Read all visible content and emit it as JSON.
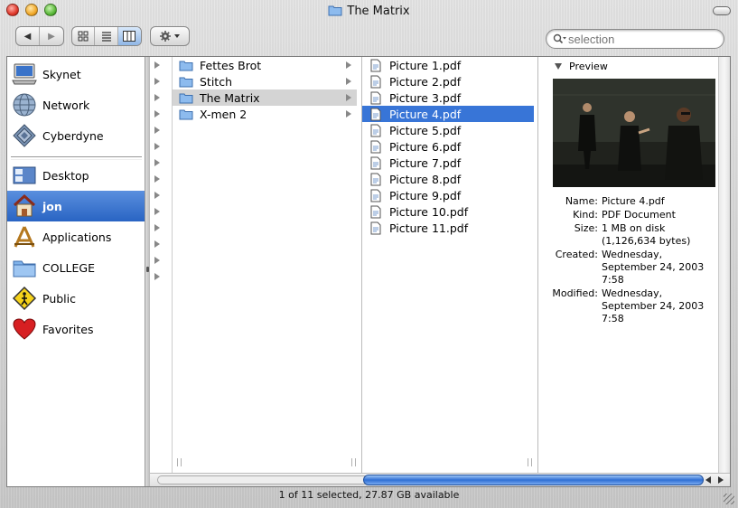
{
  "window": {
    "title": "The Matrix"
  },
  "toolbar": {
    "back_label": "◀",
    "forward_label": "▶",
    "search": {
      "placeholder": "selection"
    }
  },
  "sidebar": {
    "devices": [
      {
        "label": "Skynet",
        "icon": "computer-icon"
      },
      {
        "label": "Network",
        "icon": "network-globe-icon"
      },
      {
        "label": "Cyberdyne",
        "icon": "server-disk-icon"
      }
    ],
    "places": [
      {
        "label": "Desktop",
        "icon": "desktop-icon"
      },
      {
        "label": "jon",
        "icon": "home-icon",
        "selected": true
      },
      {
        "label": "Applications",
        "icon": "applications-icon"
      },
      {
        "label": "COLLEGE",
        "icon": "folder-icon"
      },
      {
        "label": "Public",
        "icon": "public-sign-icon"
      },
      {
        "label": "Favorites",
        "icon": "heart-icon"
      }
    ]
  },
  "columns": {
    "folders": [
      {
        "label": "Fettes Brot"
      },
      {
        "label": "Stitch"
      },
      {
        "label": "The Matrix",
        "selected": true
      },
      {
        "label": "X-men 2"
      }
    ],
    "files": [
      {
        "label": "Picture 1.pdf"
      },
      {
        "label": "Picture 2.pdf"
      },
      {
        "label": "Picture 3.pdf"
      },
      {
        "label": "Picture 4.pdf",
        "selected": true
      },
      {
        "label": "Picture 5.pdf"
      },
      {
        "label": "Picture 6.pdf"
      },
      {
        "label": "Picture 7.pdf"
      },
      {
        "label": "Picture 8.pdf"
      },
      {
        "label": "Picture 9.pdf"
      },
      {
        "label": "Picture 10.pdf"
      },
      {
        "label": "Picture 11.pdf"
      }
    ]
  },
  "preview": {
    "heading": "Preview",
    "info": [
      {
        "key": "Name:",
        "value": "Picture 4.pdf"
      },
      {
        "key": "Kind:",
        "value": "PDF Document"
      },
      {
        "key": "Size:",
        "value": "1 MB on disk (1,126,634 bytes)"
      },
      {
        "key": "Created:",
        "value": "Wednesday, September 24, 2003 7:58"
      },
      {
        "key": "Modified:",
        "value": "Wednesday, September 24, 2003 7:58"
      }
    ]
  },
  "status": {
    "text": "1 of 11 selected, 27.87 GB available"
  },
  "colors": {
    "selection_blue": "#3875d7",
    "sidebar_selected": "#2964c3",
    "folder_blue": "#7fb2ea"
  }
}
